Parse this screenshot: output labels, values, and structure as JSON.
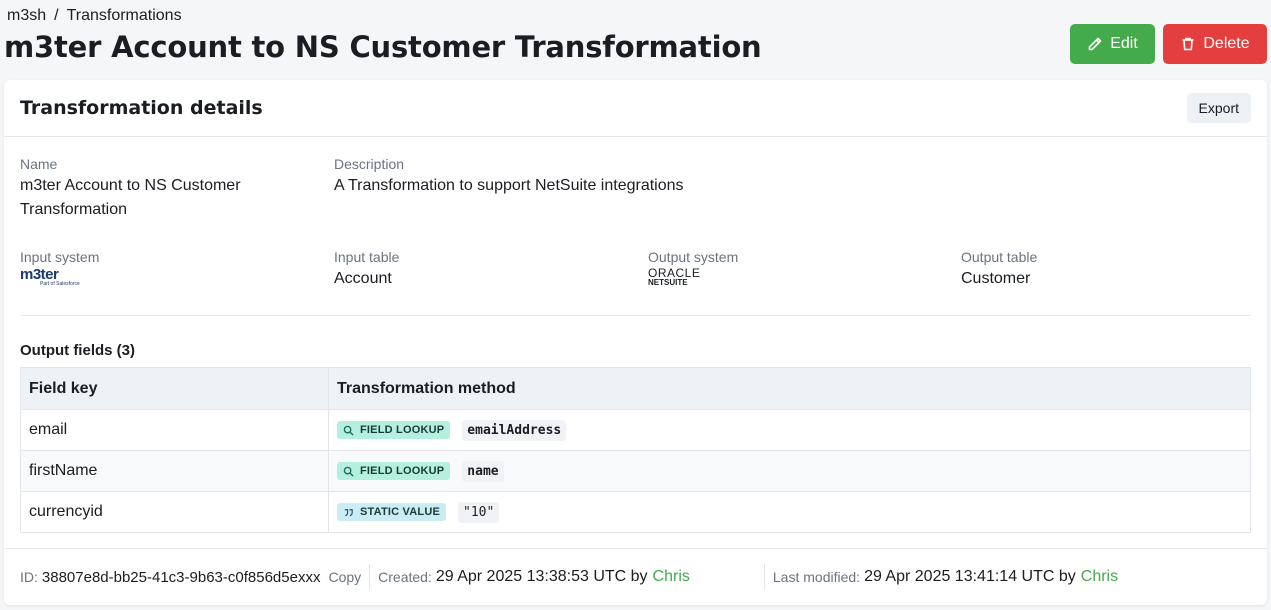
{
  "breadcrumb": {
    "root": "m3sh",
    "separator": "/",
    "current": "Transformations"
  },
  "page": {
    "title": "m3ter Account to NS Customer Transformation"
  },
  "actions": {
    "edit_label": "Edit",
    "delete_label": "Delete"
  },
  "card": {
    "title": "Transformation details",
    "export_label": "Export"
  },
  "details": {
    "name_label": "Name",
    "name_value": "m3ter Account to NS Customer Transformation",
    "description_label": "Description",
    "description_value": "A Transformation to support NetSuite integrations",
    "input_system_label": "Input system",
    "input_system_logo": "m3ter",
    "input_system_logo_sub": "Part of Salesforce",
    "input_table_label": "Input table",
    "input_table_value": "Account",
    "output_system_label": "Output system",
    "output_system_logo": "ORACLE",
    "output_system_logo_sub": "NETSUITE",
    "output_table_label": "Output table",
    "output_table_value": "Customer"
  },
  "output_fields": {
    "title": "Output fields (3)",
    "headers": {
      "key": "Field key",
      "method": "Transformation method"
    },
    "rows": [
      {
        "key": "email",
        "method": "FIELD LOOKUP",
        "value": "emailAddress"
      },
      {
        "key": "firstName",
        "method": "FIELD LOOKUP",
        "value": "name"
      },
      {
        "key": "currencyid",
        "method": "STATIC VALUE",
        "value": "\"10\""
      }
    ]
  },
  "footer": {
    "id_label": "ID:",
    "id_value": "38807e8d-bb25-41c3-9b63-c0f856d5exxx",
    "copy_label": "Copy",
    "created_label": "Created:",
    "created_value": "29 Apr 2025 13:38:53 UTC by",
    "created_by": "Chris",
    "modified_label": "Last modified:",
    "modified_value": "29 Apr 2025 13:41:14 UTC by",
    "modified_by": "Chris"
  },
  "colors": {
    "edit": "#43ab4b",
    "delete": "#e53e3e",
    "link": "#43ab4b",
    "lookup_badge": "#b5f0df",
    "static_badge": "#c9ecf5"
  }
}
